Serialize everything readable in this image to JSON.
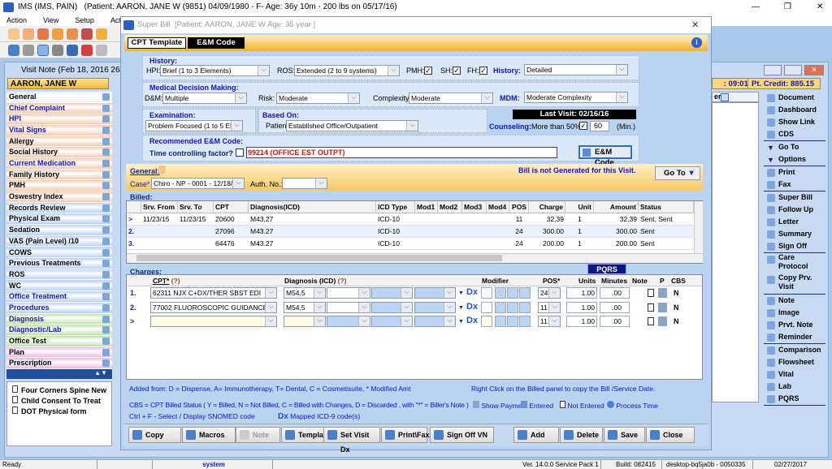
{
  "app": {
    "title": "IMS (IMS, PAIN)",
    "patient_header": "(Patient: AARON, JANE W (9851) 04/09/1980 - F- Age: 36y 10m - 200 lbs on 05/17/16)"
  },
  "menu": [
    "Action",
    "View",
    "Setup",
    "Activities"
  ],
  "visit_note": {
    "title": "Visit Note (Feb 18, 2016  264 of",
    "patient_name": "AARON, JANE W",
    "time": ": 09:01 A",
    "credit": "Pt. Credit: 885.15",
    "panel_label": "er"
  },
  "sidebar": [
    {
      "label": "General",
      "bg": "#eef4fc",
      "color": "#000"
    },
    {
      "label": "Chief Complaint",
      "bg": "#f6c8ae",
      "color": "#1313d0"
    },
    {
      "label": "HPI",
      "bg": "#f6c8ae",
      "color": "#1313d0"
    },
    {
      "label": "Vital Signs",
      "bg": "#f6c8ae",
      "color": "#1313d0"
    },
    {
      "label": "Allergy",
      "bg": "#f6c8ae",
      "color": "#000"
    },
    {
      "label": "Social History",
      "bg": "#f6c8ae",
      "color": "#000"
    },
    {
      "label": "Current Medication",
      "bg": "#f6c8ae",
      "color": "#1313d0"
    },
    {
      "label": "Family History",
      "bg": "#f6c8ae",
      "color": "#000"
    },
    {
      "label": "PMH",
      "bg": "#f6c8ae",
      "color": "#000"
    },
    {
      "label": "Oswestry Index",
      "bg": "#f6c8ae",
      "color": "#000"
    },
    {
      "label": "Records Review",
      "bg": "#b8d0f8",
      "color": "#000"
    },
    {
      "label": "Physical Exam",
      "bg": "#b8d0f8",
      "color": "#000"
    },
    {
      "label": "Sedation",
      "bg": "#b8d0f8",
      "color": "#000"
    },
    {
      "label": "VAS (Pain Level)  /10",
      "bg": "#b8d0f8",
      "color": "#000"
    },
    {
      "label": "COWS",
      "bg": "#b8d0f8",
      "color": "#000"
    },
    {
      "label": "Previous Treatments",
      "bg": "#b8d0f8",
      "color": "#000"
    },
    {
      "label": "ROS",
      "bg": "#b8d0f8",
      "color": "#000"
    },
    {
      "label": "WC",
      "bg": "#b8d0f8",
      "color": "#000"
    },
    {
      "label": "Office Treatment",
      "bg": "#b8d0f8",
      "color": "#1313d0"
    },
    {
      "label": "Procedures",
      "bg": "#b8d0f8",
      "color": "#1313d0"
    },
    {
      "label": "Diagnosis",
      "bg": "#bde3a6",
      "color": "#1313d0"
    },
    {
      "label": "Diagnostic/Lab",
      "bg": "#bde3a6",
      "color": "#1313d0"
    },
    {
      "label": "Office Test",
      "bg": "#bde3a6",
      "color": "#000"
    },
    {
      "label": "Plan",
      "bg": "#eab8e6",
      "color": "#000"
    },
    {
      "label": "Prescription",
      "bg": "#eab8e6",
      "color": "#000"
    }
  ],
  "forms": [
    "Four Corners Spine New",
    "Child Consent To Treat",
    "DOT Physical form"
  ],
  "right_sidebar": [
    {
      "label": "Document",
      "icon": "document-icon",
      "sep": false
    },
    {
      "label": "Dashboard",
      "icon": "dashboard-icon",
      "sep": false
    },
    {
      "label": "Show Link",
      "icon": "link-icon",
      "sep": false
    },
    {
      "label": "CDS",
      "icon": "cds-icon",
      "sep": true
    },
    {
      "label": "Go To",
      "icon": "triangle-down-icon",
      "sep": false
    },
    {
      "label": "Options",
      "icon": "triangle-down-icon",
      "sep": true
    },
    {
      "label": "Print",
      "icon": "print-icon",
      "sep": false
    },
    {
      "label": "Fax",
      "icon": "fax-icon",
      "sep": true
    },
    {
      "label": "Super Bill",
      "icon": "super-bill-icon",
      "sep": false
    },
    {
      "label": "Follow Up",
      "icon": "calendar-icon",
      "sep": false
    },
    {
      "label": "Letter",
      "icon": "letter-icon",
      "sep": false
    },
    {
      "label": "Summary",
      "icon": "summary-icon",
      "sep": false
    },
    {
      "label": "Sign Off",
      "icon": "sign-off-icon",
      "sep": true
    },
    {
      "label": "Care Protocol",
      "icon": "copy-icon",
      "sep": false,
      "two": true
    },
    {
      "label": "Copy Prv. Visit",
      "icon": "copy-icon",
      "sep": true,
      "two": true
    },
    {
      "label": "Note",
      "icon": "note-icon",
      "sep": false
    },
    {
      "label": "Image",
      "icon": "image-icon",
      "sep": false
    },
    {
      "label": "Prvt. Note",
      "icon": "private-note-icon",
      "sep": false
    },
    {
      "label": "Reminder",
      "icon": "reminder-icon",
      "sep": true
    },
    {
      "label": "Comparison",
      "icon": "checklist-icon",
      "sep": false
    },
    {
      "label": "Flowsheet",
      "icon": "checklist-icon",
      "sep": false
    },
    {
      "label": "Vital",
      "icon": "checklist-icon",
      "sep": false
    },
    {
      "label": "Lab",
      "icon": "checklist-icon",
      "sep": false
    },
    {
      "label": "PQRS",
      "icon": "checklist-icon",
      "sep": true
    }
  ],
  "dialog": {
    "title": "Super Bill",
    "subtitle": "[Patient: AARON, JANE W  Age: 35 year ]",
    "tabs": [
      "CPT Template",
      "E&M Code"
    ]
  },
  "em": {
    "history_label": "History:",
    "hpi_label": "HPI:",
    "hpi": "Brief (1 to 3 Elements)",
    "ros_label": "ROS:",
    "ros": "Extended (2 to 9 systems)",
    "pmh_label": "PMH:",
    "pmh": true,
    "sh_label": "SH:",
    "sh": true,
    "fh_label": "FH:",
    "fh": true,
    "history_result_label": "History:",
    "history_result": "Detailed",
    "mdm_group_label": "Medical Decision Making:",
    "dm_label": "D&M:",
    "dm": "Multiple",
    "risk_label": "Risk:",
    "risk": "Moderate",
    "complexity_label": "Complexity:",
    "complexity": "Moderate",
    "mdm_label": "MDM:",
    "mdm": "Moderate Complexity",
    "exam_label": "Examination:",
    "exam": "Problem Focused (1 to 5 Elemen",
    "based_on_label": "Based On:",
    "patient_label": "Patient:",
    "patient": "Established Office/Outpatient",
    "last_visit": "Last Visit: 02/16/16",
    "counseling_label": "Counseling:",
    "more_than_label": "More than 50%:",
    "more_than": true,
    "minutes": "60",
    "min_label": "(Min.)",
    "recommended_label": "Recommended E&M Code:",
    "time_factor_label": "Time controlling factor?",
    "time_factor": false,
    "code": "99214  (OFFICE EST OUTPT)",
    "em_button": "E&M Code"
  },
  "general": {
    "label": "General:",
    "case_label": "Case*",
    "case": "Chiro - NP  -  0001 - 12/18/",
    "auth_label": "Auth. No.:",
    "auth": "",
    "bill_status": "Bill is not Generated for this Visit.",
    "goto": "Go To"
  },
  "billed": {
    "label": "Billed:",
    "columns": [
      "",
      "Srv. From",
      "Srv. To",
      "CPT",
      "Diagnosis(ICD)",
      "ICD Type",
      "Mod1",
      "Mod2",
      "Mod3",
      "Mod4",
      "POS",
      "Charge",
      "Unit",
      "Amount",
      "Status"
    ],
    "rows": [
      [
        ">",
        "11/23/15",
        "11/23/15",
        "20600",
        "M43.27",
        "ICD-10",
        "",
        "",
        "",
        "",
        "11",
        "32.39",
        "1",
        "32.39",
        "Sent, Sent"
      ],
      [
        "2.",
        "",
        "",
        "27096",
        "M43.27",
        "ICD-10",
        "",
        "",
        "",
        "",
        "24",
        "300.00",
        "1",
        "300.00",
        "Sent"
      ],
      [
        "3.",
        "",
        "",
        "64476",
        "M43.27",
        "ICD-10",
        "",
        "",
        "",
        "",
        "24",
        "200.00",
        "1",
        "200.00",
        "Sent"
      ]
    ]
  },
  "charges": {
    "label": "Charges:",
    "pqrs": "PQRS",
    "headers": {
      "cpt": "CPT*",
      "cpt_help": "(?)",
      "diag": "Diagnosis (ICD)",
      "diag_help": "(?)",
      "modifier": "Modifier",
      "pos": "POS*",
      "units": "Units",
      "minutes": "Minutes",
      "note": "Note",
      "p": "P",
      "cbs": "CBS"
    },
    "rows": [
      {
        "num": "1.",
        "cpt": "62311     NJX C+DX/THER SBST EDI",
        "diag": "M54.5",
        "pos": "24",
        "units": "1.00",
        "minutes": ".00",
        "cbs": "N"
      },
      {
        "num": "2.",
        "cpt": "77002     FLUOROSCOPIC GUIDANCE",
        "diag": "M54.5",
        "pos": "11",
        "units": "1.00",
        "minutes": ".00",
        "cbs": "N"
      },
      {
        "num": ">",
        "cpt": "",
        "diag": "",
        "pos": "11",
        "units": "1.00",
        "minutes": ".00",
        "cbs": "N"
      }
    ],
    "dx": "Dx"
  },
  "legend": {
    "line1": "Added from: D = Dispense, A= Immunotherapy, T= Dental,  C = Cosmetisuite,   * Modified Amt",
    "right_click": "Right Click on the Billed panel to copy the Bill /Service Date.",
    "line2": "CBS = CPT Billed Status ( Y = Billed, N = Not Billed, C = Billed with Changes, D = Discarded , with \"*\" = Biller's Note )",
    "show_payment": "Show Payment",
    "entered": "Entered",
    "not_entered": "Not Entered",
    "process_time": "Process Time",
    "line3": "Ctrl + F - Select / Display SNOMED code",
    "mapped": "Mapped ICD-9 code(s)"
  },
  "buttons": [
    {
      "label": "Copy",
      "icon": "copy-icon",
      "disabled": false
    },
    {
      "label": "Macros",
      "icon": "macros-icon",
      "disabled": false
    },
    {
      "label": "Note",
      "icon": "note-icon",
      "disabled": true
    },
    {
      "label": "Template",
      "icon": "template-icon",
      "disabled": false
    },
    {
      "label": "Set Visit Dx",
      "icon": "dx-icon",
      "disabled": false
    },
    {
      "label": "Print\\Fax",
      "icon": "print-icon",
      "disabled": false
    },
    {
      "label": "Sign Off VN",
      "icon": "sign-off-icon",
      "disabled": false
    },
    {
      "label": "Add",
      "icon": "add-icon",
      "disabled": false
    },
    {
      "label": "Delete",
      "icon": "delete-icon",
      "disabled": false
    },
    {
      "label": "Save",
      "icon": "save-icon",
      "disabled": false
    },
    {
      "label": "Close",
      "icon": "close-icon",
      "disabled": false
    }
  ],
  "status": {
    "ready": "Ready",
    "user": "system",
    "version": "Ver. 14.0.0 Service Pack 1",
    "build": "Build: 082415",
    "machine": "desktop-bq5ja0b - 0050335",
    "date": "02/27/2017"
  },
  "colors": {
    "accent_orange": "#f7b733",
    "title_blue": "#1313d0",
    "code_red": "#e01010"
  }
}
